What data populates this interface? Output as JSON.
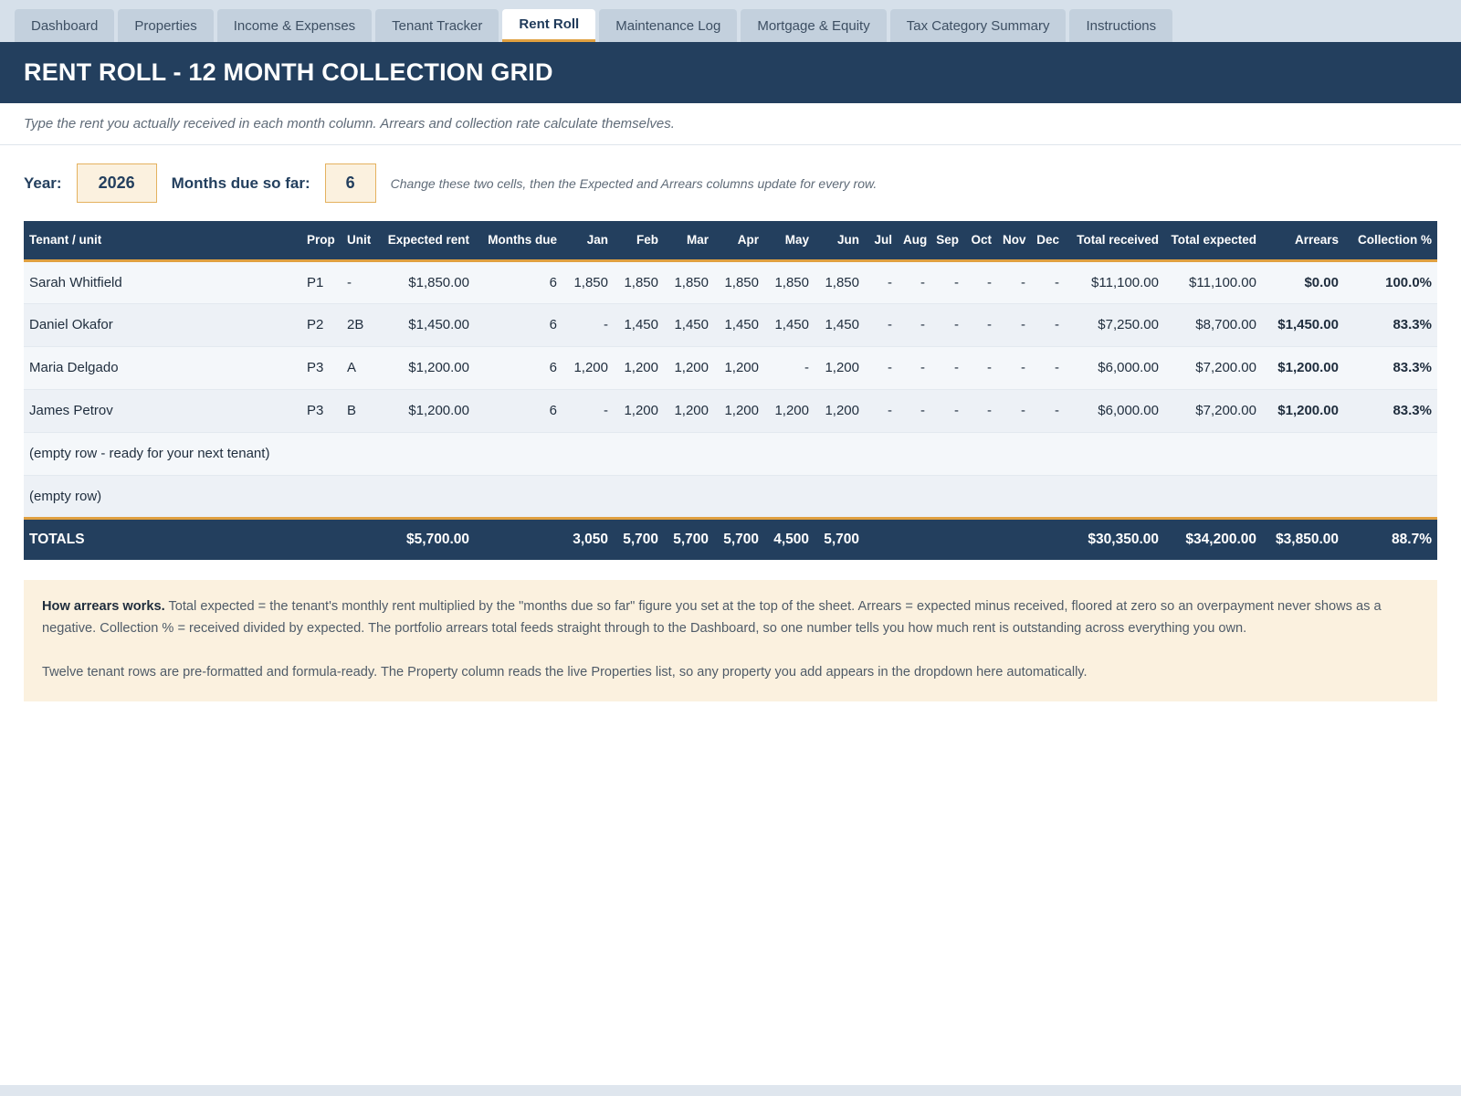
{
  "tabs": [
    {
      "label": "Dashboard",
      "active": false
    },
    {
      "label": "Properties",
      "active": false
    },
    {
      "label": "Income & Expenses",
      "active": false
    },
    {
      "label": "Tenant Tracker",
      "active": false
    },
    {
      "label": "Rent Roll",
      "active": true
    },
    {
      "label": "Maintenance Log",
      "active": false
    },
    {
      "label": "Mortgage & Equity",
      "active": false
    },
    {
      "label": "Tax Category Summary",
      "active": false
    },
    {
      "label": "Instructions",
      "active": false
    }
  ],
  "header": {
    "title": "RENT ROLL - 12 MONTH COLLECTION GRID",
    "subtitle": "Type the rent you actually received in each month column. Arrears and collection rate calculate themselves."
  },
  "controls": {
    "year_label": "Year:",
    "year_value": "2026",
    "months_label": "Months due so far:",
    "months_value": "6",
    "hint": "Change these two cells, then the Expected and Arrears columns update for every row."
  },
  "table": {
    "columns": [
      "Tenant / unit",
      "Prop",
      "Unit",
      "Expected rent",
      "Months due",
      "Jan",
      "Feb",
      "Mar",
      "Apr",
      "May",
      "Jun",
      "Jul",
      "Aug",
      "Sep",
      "Oct",
      "Nov",
      "Dec",
      "Total received",
      "Total expected",
      "Arrears",
      "Collection %"
    ],
    "rows": [
      {
        "tenant": "Sarah Whitfield",
        "prop": "P1",
        "unit": "-",
        "expected": "$1,850.00",
        "months_due": "6",
        "months": [
          "1,850",
          "1,850",
          "1,850",
          "1,850",
          "1,850",
          "1,850",
          "-",
          "-",
          "-",
          "-",
          "-",
          "-"
        ],
        "total_received": "$11,100.00",
        "total_expected": "$11,100.00",
        "arrears": "$0.00",
        "collection": "100.0%"
      },
      {
        "tenant": "Daniel Okafor",
        "prop": "P2",
        "unit": "2B",
        "expected": "$1,450.00",
        "months_due": "6",
        "months": [
          "-",
          "1,450",
          "1,450",
          "1,450",
          "1,450",
          "1,450",
          "-",
          "-",
          "-",
          "-",
          "-",
          "-"
        ],
        "total_received": "$7,250.00",
        "total_expected": "$8,700.00",
        "arrears": "$1,450.00",
        "collection": "83.3%"
      },
      {
        "tenant": "Maria Delgado",
        "prop": "P3",
        "unit": "A",
        "expected": "$1,200.00",
        "months_due": "6",
        "months": [
          "1,200",
          "1,200",
          "1,200",
          "1,200",
          "-",
          "1,200",
          "-",
          "-",
          "-",
          "-",
          "-",
          "-"
        ],
        "total_received": "$6,000.00",
        "total_expected": "$7,200.00",
        "arrears": "$1,200.00",
        "collection": "83.3%"
      },
      {
        "tenant": "James Petrov",
        "prop": "P3",
        "unit": "B",
        "expected": "$1,200.00",
        "months_due": "6",
        "months": [
          "-",
          "1,200",
          "1,200",
          "1,200",
          "1,200",
          "1,200",
          "-",
          "-",
          "-",
          "-",
          "-",
          "-"
        ],
        "total_received": "$6,000.00",
        "total_expected": "$7,200.00",
        "arrears": "$1,200.00",
        "collection": "83.3%"
      }
    ],
    "empty_rows": [
      "(empty row - ready for your next tenant)",
      "(empty row)"
    ],
    "totals": {
      "label": "TOTALS",
      "expected": "$5,700.00",
      "months": [
        "3,050",
        "5,700",
        "5,700",
        "5,700",
        "4,500",
        "5,700",
        "",
        "",
        "",
        "",
        "",
        ""
      ],
      "total_received": "$30,350.00",
      "total_expected": "$34,200.00",
      "arrears": "$3,850.00",
      "collection": "88.7%"
    }
  },
  "note": {
    "heading": "How arrears works.",
    "body": " Total expected = the tenant's monthly rent multiplied by the \"months due so far\" figure you set at the top of the sheet. Arrears = expected minus received, floored at zero so an overpayment never shows as a negative. Collection % = received divided by expected. The portfolio arrears total feeds straight through to the Dashboard, so one number tells you how much rent is outstanding across everything you own.",
    "second": "Twelve tenant rows are pre-formatted and formula-ready. The Property column reads the live Properties list, so any property you add appears in the dropdown here automatically."
  },
  "colors": {
    "navy": "#233f5e",
    "accent": "#e0a040",
    "arrears_red": "#b22b22",
    "note_bg": "#fbf1df"
  }
}
